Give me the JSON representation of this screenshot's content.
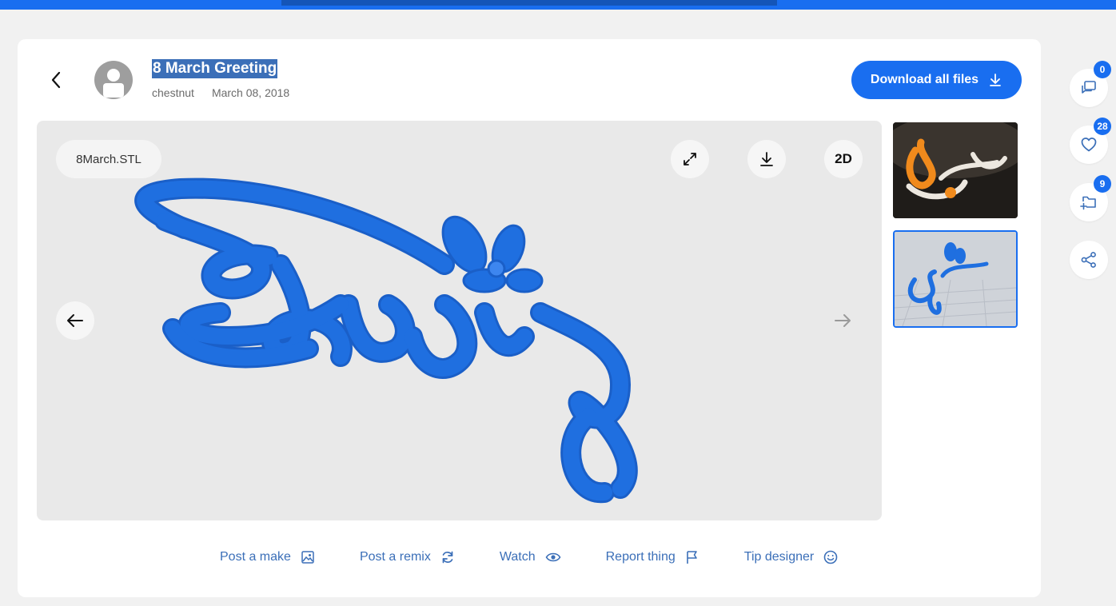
{
  "header": {
    "title": "8 March Greeting",
    "author": "chestnut",
    "date": "March 08, 2018",
    "download_all_label": "Download all files"
  },
  "viewer": {
    "file_name": "8March.STL",
    "mode_label": "2D",
    "model_color": "#1f6fe0"
  },
  "actions": [
    {
      "label": "Post a make",
      "icon": "image-icon"
    },
    {
      "label": "Post a remix",
      "icon": "refresh-icon"
    },
    {
      "label": "Watch",
      "icon": "eye-icon"
    },
    {
      "label": "Report thing",
      "icon": "flag-icon"
    },
    {
      "label": "Tip designer",
      "icon": "smile-icon"
    }
  ],
  "sidebar": {
    "comments_count": "0",
    "likes_count": "28",
    "collections_count": "9"
  },
  "colors": {
    "accent": "#196ef0",
    "link": "#3b6fb8"
  }
}
